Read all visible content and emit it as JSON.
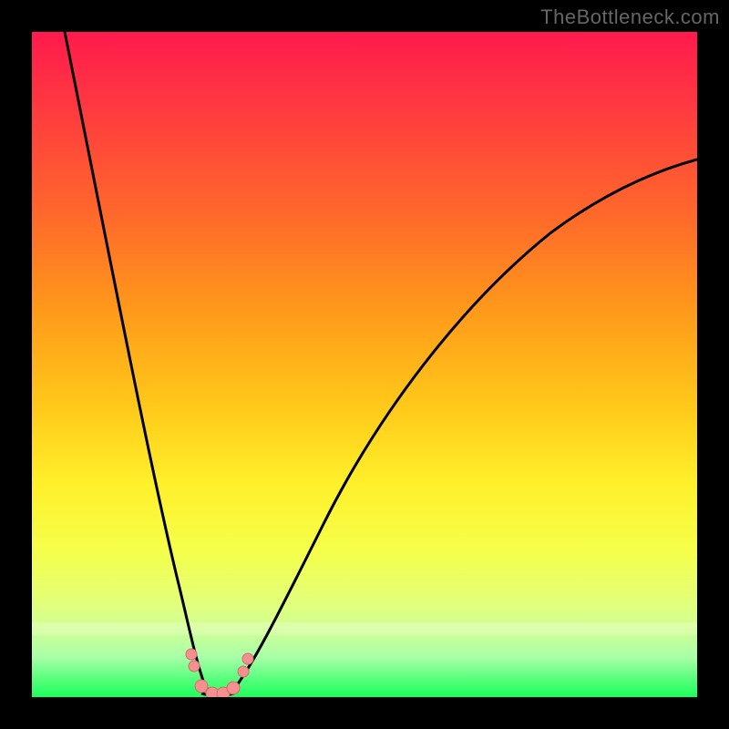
{
  "watermark": "TheBottleneck.com",
  "colors": {
    "frame": "#000000",
    "curve": "#000000",
    "marker_fill": "#f49090",
    "marker_stroke": "#d86a6a",
    "gradient_top": "#ff1a4d",
    "gradient_bottom": "#1aff5a"
  },
  "chart_data": {
    "type": "line",
    "title": "",
    "xlabel": "",
    "ylabel": "",
    "xlim": [
      0,
      1
    ],
    "ylim": [
      0,
      100
    ],
    "series": [
      {
        "name": "bottleneck_curve",
        "x": [
          0.0,
          0.05,
          0.1,
          0.15,
          0.18,
          0.2,
          0.22,
          0.24,
          0.26,
          0.28,
          0.3,
          0.33,
          0.37,
          0.42,
          0.5,
          0.6,
          0.7,
          0.8,
          0.9,
          1.0
        ],
        "y": [
          100,
          78,
          56,
          35,
          22,
          14,
          7,
          3,
          0,
          0,
          0,
          3,
          8,
          16,
          30,
          46,
          58,
          68,
          76,
          82
        ]
      }
    ],
    "annotations": {
      "optimal_range_x": [
        0.24,
        0.3
      ],
      "optimal_value_y": 0,
      "markers": [
        {
          "x": 0.235,
          "y": 6.5,
          "r": 6
        },
        {
          "x": 0.24,
          "y": 4.0,
          "r": 6
        },
        {
          "x": 0.253,
          "y": 1.0,
          "r": 7
        },
        {
          "x": 0.27,
          "y": 0.3,
          "r": 7
        },
        {
          "x": 0.285,
          "y": 0.3,
          "r": 7
        },
        {
          "x": 0.3,
          "y": 1.0,
          "r": 7
        },
        {
          "x": 0.318,
          "y": 3.5,
          "r": 6
        },
        {
          "x": 0.323,
          "y": 5.5,
          "r": 6
        }
      ]
    }
  }
}
